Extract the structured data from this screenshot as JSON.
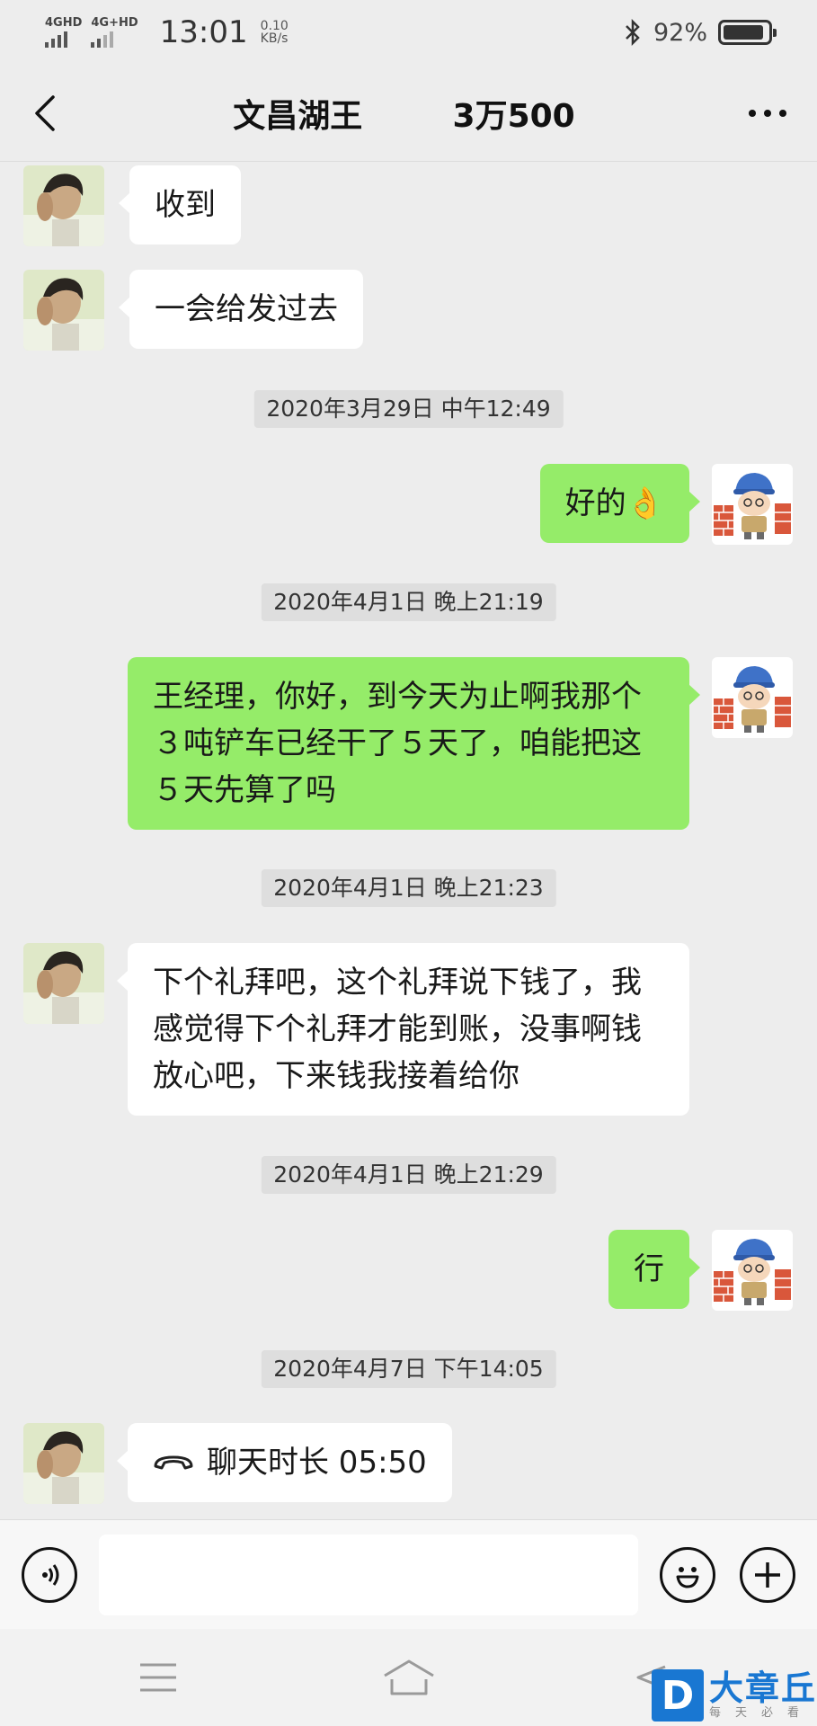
{
  "status_bar": {
    "signal1_label": "4GHD",
    "signal2_label": "4G+HD",
    "time": "13:01",
    "speed_value": "0.10",
    "speed_unit": "KB/s",
    "battery_percent": "92%",
    "battery_level": 0.92
  },
  "header": {
    "title": "文昌湖王        3万500",
    "back_icon": "chevron-left-icon",
    "more_icon": "more-dots-icon"
  },
  "messages": [
    {
      "side": "left",
      "text": "收到"
    },
    {
      "side": "left",
      "text": "一会给发过去"
    },
    {
      "type": "time",
      "text": "2020年3月29日 中午12:49"
    },
    {
      "side": "right",
      "text": "好的👌"
    },
    {
      "type": "time",
      "text": "2020年4月1日 晚上21:19"
    },
    {
      "side": "right",
      "text": "王经理，你好，到今天为止啊我那个３吨铲车已经干了５天了，咱能把这５天先算了吗"
    },
    {
      "type": "time",
      "text": "2020年4月1日 晚上21:23"
    },
    {
      "side": "left",
      "text": "下个礼拜吧，这个礼拜说下钱了，我感觉得下个礼拜才能到账，没事啊钱放心吧，下来钱我接着给你"
    },
    {
      "type": "time",
      "text": "2020年4月1日 晚上21:29"
    },
    {
      "side": "right",
      "text": "行"
    },
    {
      "type": "time",
      "text": "2020年4月7日 下午14:05"
    },
    {
      "side": "left",
      "call_icon": "phone-hangup-icon",
      "text": "聊天时长 05:50"
    }
  ],
  "input_bar": {
    "voice_icon": "voice-icon",
    "emoji_icon": "emoji-icon",
    "plus_icon": "plus-icon",
    "placeholder": ""
  },
  "watermark": {
    "logo_letter": "D",
    "name": "大章丘",
    "slogan": "每天必看"
  },
  "colors": {
    "background": "#ededed",
    "bubble_green": "#95ec69",
    "bubble_white": "#ffffff",
    "watermark_blue": "#1977d2"
  }
}
